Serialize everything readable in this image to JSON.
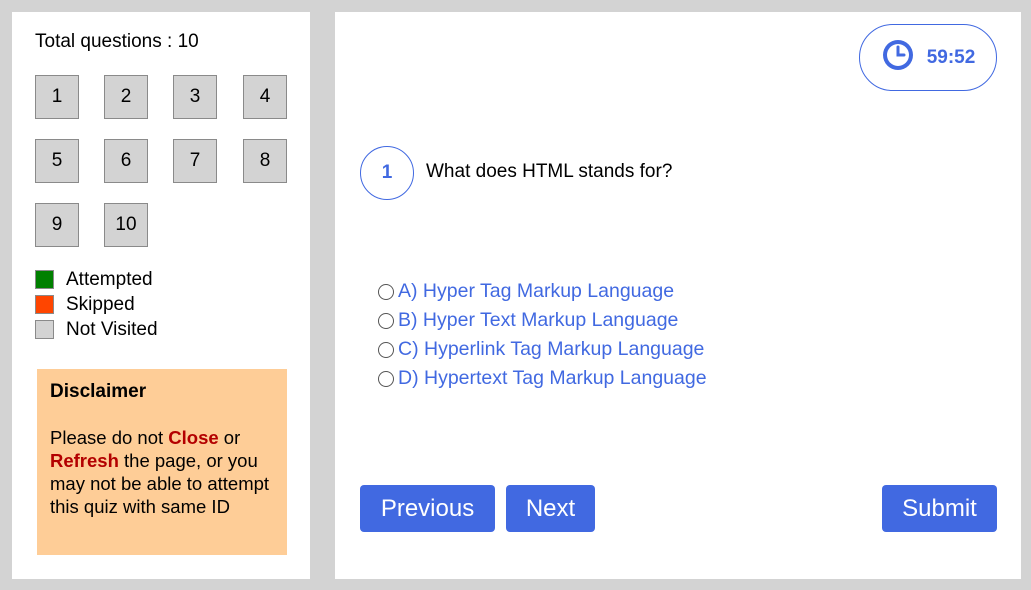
{
  "sidebar": {
    "total_label": "Total questions : 10",
    "questions": [
      "1",
      "2",
      "3",
      "4",
      "5",
      "6",
      "7",
      "8",
      "9",
      "10"
    ],
    "legend": [
      {
        "label": "Attempted",
        "color": "#008000"
      },
      {
        "label": "Skipped",
        "color": "#ff4500"
      },
      {
        "label": "Not Visited",
        "color": "#d3d3d3"
      }
    ],
    "disclaimer": {
      "title": "Disclaimer",
      "text_1": "Please do not ",
      "close": "Close",
      "text_2": " or ",
      "refresh": "Refresh",
      "text_3": " the page, or you may not be able to attempt this quiz with same ID"
    }
  },
  "main": {
    "timer": "59:52",
    "question_number": "1",
    "question_text": "What does HTML stands for?",
    "options": [
      "A) Hyper Tag Markup Language",
      "B) Hyper Text Markup Language",
      "C) Hyperlink Tag Markup Language",
      "D) Hypertext Tag Markup Language"
    ],
    "buttons": {
      "previous": "Previous",
      "next": "Next",
      "submit": "Submit"
    }
  },
  "colors": {
    "accent": "#4169e1",
    "disclaimer_bg": "#fecd97",
    "warning_text": "#b30000"
  },
  "icons": {
    "timer": "clock-icon"
  }
}
